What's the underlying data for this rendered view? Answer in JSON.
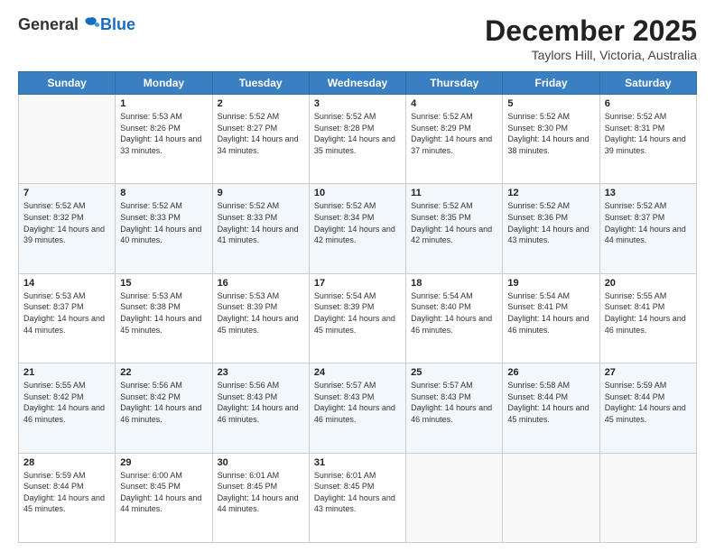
{
  "logo": {
    "general": "General",
    "blue": "Blue"
  },
  "title": "December 2025",
  "subtitle": "Taylors Hill, Victoria, Australia",
  "days_of_week": [
    "Sunday",
    "Monday",
    "Tuesday",
    "Wednesday",
    "Thursday",
    "Friday",
    "Saturday"
  ],
  "weeks": [
    [
      {
        "day": "",
        "sunrise": "",
        "sunset": "",
        "daylight": ""
      },
      {
        "day": "1",
        "sunrise": "5:53 AM",
        "sunset": "8:26 PM",
        "daylight": "14 hours and 33 minutes."
      },
      {
        "day": "2",
        "sunrise": "5:52 AM",
        "sunset": "8:27 PM",
        "daylight": "14 hours and 34 minutes."
      },
      {
        "day": "3",
        "sunrise": "5:52 AM",
        "sunset": "8:28 PM",
        "daylight": "14 hours and 35 minutes."
      },
      {
        "day": "4",
        "sunrise": "5:52 AM",
        "sunset": "8:29 PM",
        "daylight": "14 hours and 37 minutes."
      },
      {
        "day": "5",
        "sunrise": "5:52 AM",
        "sunset": "8:30 PM",
        "daylight": "14 hours and 38 minutes."
      },
      {
        "day": "6",
        "sunrise": "5:52 AM",
        "sunset": "8:31 PM",
        "daylight": "14 hours and 39 minutes."
      }
    ],
    [
      {
        "day": "7",
        "sunrise": "5:52 AM",
        "sunset": "8:32 PM",
        "daylight": "14 hours and 39 minutes."
      },
      {
        "day": "8",
        "sunrise": "5:52 AM",
        "sunset": "8:33 PM",
        "daylight": "14 hours and 40 minutes."
      },
      {
        "day": "9",
        "sunrise": "5:52 AM",
        "sunset": "8:33 PM",
        "daylight": "14 hours and 41 minutes."
      },
      {
        "day": "10",
        "sunrise": "5:52 AM",
        "sunset": "8:34 PM",
        "daylight": "14 hours and 42 minutes."
      },
      {
        "day": "11",
        "sunrise": "5:52 AM",
        "sunset": "8:35 PM",
        "daylight": "14 hours and 42 minutes."
      },
      {
        "day": "12",
        "sunrise": "5:52 AM",
        "sunset": "8:36 PM",
        "daylight": "14 hours and 43 minutes."
      },
      {
        "day": "13",
        "sunrise": "5:52 AM",
        "sunset": "8:37 PM",
        "daylight": "14 hours and 44 minutes."
      }
    ],
    [
      {
        "day": "14",
        "sunrise": "5:53 AM",
        "sunset": "8:37 PM",
        "daylight": "14 hours and 44 minutes."
      },
      {
        "day": "15",
        "sunrise": "5:53 AM",
        "sunset": "8:38 PM",
        "daylight": "14 hours and 45 minutes."
      },
      {
        "day": "16",
        "sunrise": "5:53 AM",
        "sunset": "8:39 PM",
        "daylight": "14 hours and 45 minutes."
      },
      {
        "day": "17",
        "sunrise": "5:54 AM",
        "sunset": "8:39 PM",
        "daylight": "14 hours and 45 minutes."
      },
      {
        "day": "18",
        "sunrise": "5:54 AM",
        "sunset": "8:40 PM",
        "daylight": "14 hours and 46 minutes."
      },
      {
        "day": "19",
        "sunrise": "5:54 AM",
        "sunset": "8:41 PM",
        "daylight": "14 hours and 46 minutes."
      },
      {
        "day": "20",
        "sunrise": "5:55 AM",
        "sunset": "8:41 PM",
        "daylight": "14 hours and 46 minutes."
      }
    ],
    [
      {
        "day": "21",
        "sunrise": "5:55 AM",
        "sunset": "8:42 PM",
        "daylight": "14 hours and 46 minutes."
      },
      {
        "day": "22",
        "sunrise": "5:56 AM",
        "sunset": "8:42 PM",
        "daylight": "14 hours and 46 minutes."
      },
      {
        "day": "23",
        "sunrise": "5:56 AM",
        "sunset": "8:43 PM",
        "daylight": "14 hours and 46 minutes."
      },
      {
        "day": "24",
        "sunrise": "5:57 AM",
        "sunset": "8:43 PM",
        "daylight": "14 hours and 46 minutes."
      },
      {
        "day": "25",
        "sunrise": "5:57 AM",
        "sunset": "8:43 PM",
        "daylight": "14 hours and 46 minutes."
      },
      {
        "day": "26",
        "sunrise": "5:58 AM",
        "sunset": "8:44 PM",
        "daylight": "14 hours and 45 minutes."
      },
      {
        "day": "27",
        "sunrise": "5:59 AM",
        "sunset": "8:44 PM",
        "daylight": "14 hours and 45 minutes."
      }
    ],
    [
      {
        "day": "28",
        "sunrise": "5:59 AM",
        "sunset": "8:44 PM",
        "daylight": "14 hours and 45 minutes."
      },
      {
        "day": "29",
        "sunrise": "6:00 AM",
        "sunset": "8:45 PM",
        "daylight": "14 hours and 44 minutes."
      },
      {
        "day": "30",
        "sunrise": "6:01 AM",
        "sunset": "8:45 PM",
        "daylight": "14 hours and 44 minutes."
      },
      {
        "day": "31",
        "sunrise": "6:01 AM",
        "sunset": "8:45 PM",
        "daylight": "14 hours and 43 minutes."
      },
      {
        "day": "",
        "sunrise": "",
        "sunset": "",
        "daylight": ""
      },
      {
        "day": "",
        "sunrise": "",
        "sunset": "",
        "daylight": ""
      },
      {
        "day": "",
        "sunrise": "",
        "sunset": "",
        "daylight": ""
      }
    ]
  ]
}
